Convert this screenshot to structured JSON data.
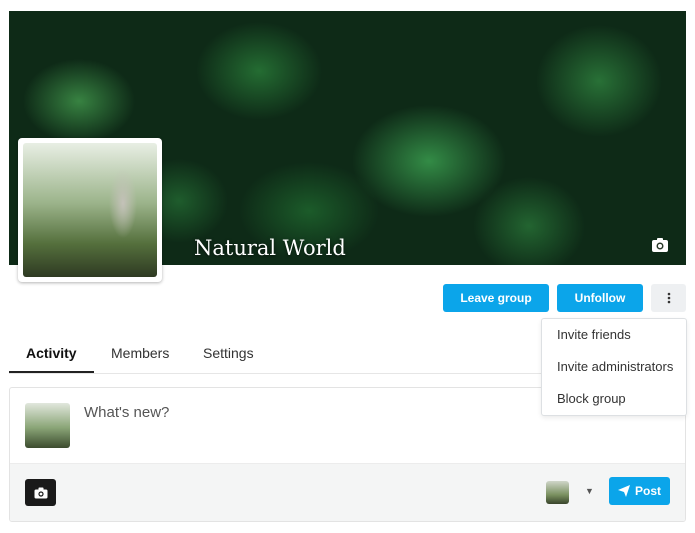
{
  "group": {
    "name": "Natural World"
  },
  "actions": {
    "leave_label": "Leave group",
    "unfollow_label": "Unfollow",
    "more_icon": "vertical-ellipsis-icon",
    "accent_color": "#0ba5ea"
  },
  "dropdown": {
    "items": [
      {
        "label": "Invite friends"
      },
      {
        "label": "Invite administrators"
      },
      {
        "label": "Block group"
      }
    ]
  },
  "tabs": [
    {
      "label": "Activity",
      "active": true
    },
    {
      "label": "Members",
      "active": false
    },
    {
      "label": "Settings",
      "active": false
    }
  ],
  "composer": {
    "placeholder": "What's new?",
    "post_label": "Post",
    "camera_icon": "camera-icon",
    "send_icon": "paper-plane-icon"
  }
}
